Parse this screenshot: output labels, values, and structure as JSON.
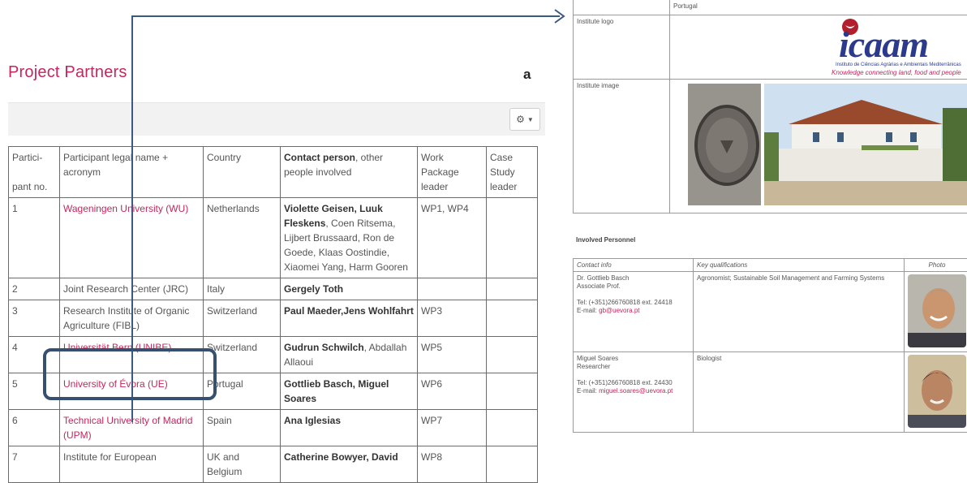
{
  "left": {
    "title": "Project Partners",
    "label": "a",
    "gear_menu": "gear-icon",
    "columns": [
      {
        "line1": "Partici-",
        "line2": "pant no."
      },
      {
        "text": "Participant legal name + acronym"
      },
      {
        "text": "Country"
      },
      {
        "bold": "Contact person",
        "rest": ", other people involved"
      },
      {
        "text": "Work Package leader"
      },
      {
        "text": "Case Study leader"
      }
    ],
    "rows": [
      {
        "no": "1",
        "name": "Wageningen University (WU)",
        "link": true,
        "country": "Netherlands",
        "contact_bold": "Violette Geisen, Luuk Fleskens",
        "contact_rest": ", Coen Ritsema, Lijbert Brussaard, Ron de Goede, Klaas Oostindie, Xiaomei Yang, Harm Gooren",
        "wp": "WP1, WP4",
        "cs": ""
      },
      {
        "no": "2",
        "name": "Joint Research Center (JRC)",
        "link": false,
        "country": "Italy",
        "contact_bold": "Gergely Toth",
        "contact_rest": "",
        "wp": "",
        "cs": ""
      },
      {
        "no": "3",
        "name": "Research Institute of Organic Agriculture (FIBL)",
        "link": false,
        "country": "Switzerland",
        "contact_bold": "Paul Maeder,Jens Wohlfahrt",
        "contact_rest": "",
        "wp": "WP3",
        "cs": ""
      },
      {
        "no": "4",
        "name": "Universität Bern (UNIBE)",
        "link": true,
        "country": "Switzerland",
        "contact_bold": "Gudrun Schwilch",
        "contact_rest": ", Abdallah Allaoui",
        "wp": "WP5",
        "cs": ""
      },
      {
        "no": "5",
        "name": "University of Évora (UE)",
        "link": true,
        "country": "Portugal",
        "contact_bold": "Gottlieb Basch, Miguel Soares",
        "contact_rest": "",
        "wp": "WP6",
        "cs": ""
      },
      {
        "no": "6",
        "name": "Technical University of Madrid (UPM)",
        "link": true,
        "country": "Spain",
        "contact_bold": "Ana Iglesias",
        "contact_rest": "",
        "wp": "WP7",
        "cs": ""
      },
      {
        "no": "7",
        "name": "Institute for European",
        "link": false,
        "country": "UK and Belgium",
        "contact_bold": "Catherine Bowyer, David",
        "contact_rest": "",
        "wp": "WP8",
        "cs": ""
      }
    ]
  },
  "institute": {
    "country_value": "Portugal",
    "logo_label": "Institute logo",
    "logo_text": "icaam",
    "logo_subtitle": "Instituto de Ciências Agrárias e Ambientais Mediterrânicas",
    "logo_tagline": "Knowledge connecting land, food and people",
    "image_label": "Institute image"
  },
  "personnel": {
    "title": "Involved Personnel",
    "headers": [
      "Contact info",
      "Key qualifications",
      "Photo"
    ],
    "people": [
      {
        "name": "Dr. Gottlieb Basch",
        "role": "Associate Prof.",
        "tel": "Tel: (+351)266760818 ext. 24418",
        "email_label": "E-mail: ",
        "email": "gb@uevora.pt",
        "qualifications": "Agronomist; Sustainable Soil Management and Farming Systems"
      },
      {
        "name": "Miguel Soares",
        "role": "Researcher",
        "tel": "Tel: (+351)266760818 ext. 24430",
        "email_label": "E-mail: ",
        "email": "miguel.soares@uevora.pt",
        "qualifications": "Biologist"
      }
    ]
  },
  "colors": {
    "accent": "#c4265d",
    "highlight": "#36506f",
    "arrow": "#3a5a80"
  }
}
